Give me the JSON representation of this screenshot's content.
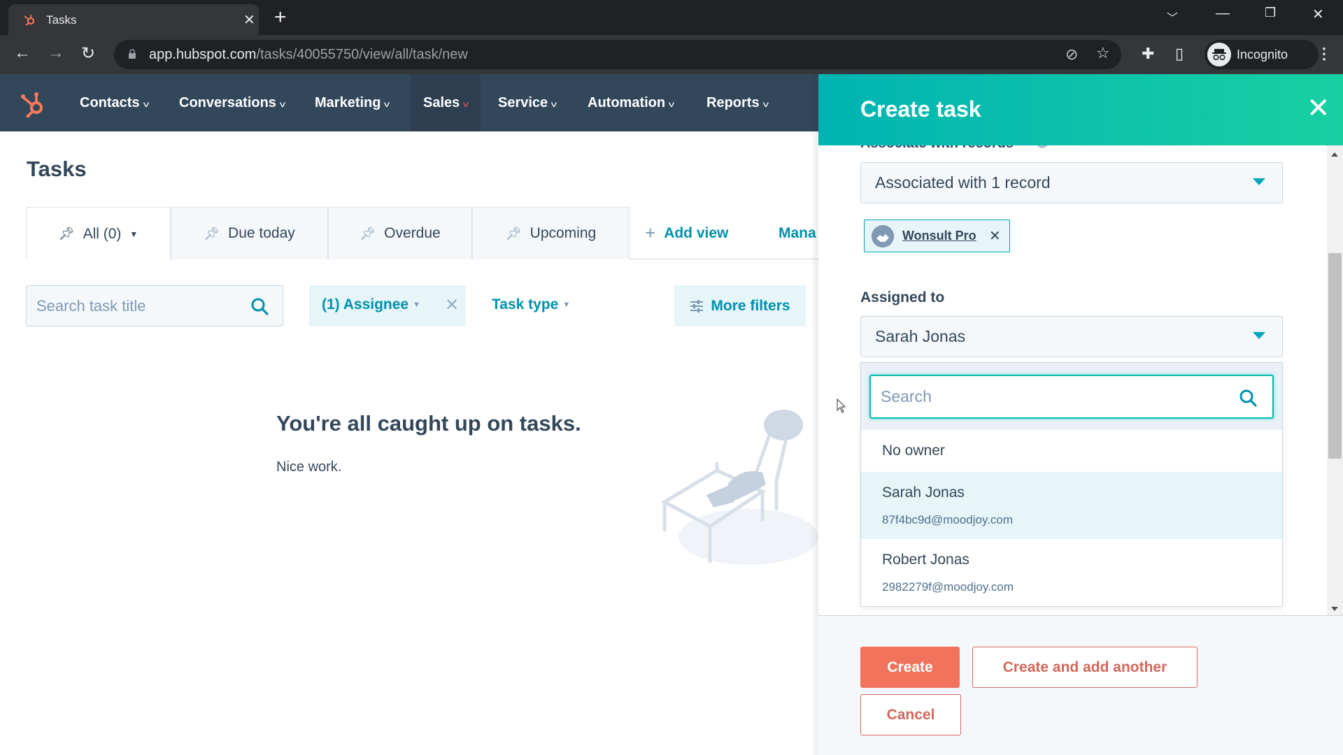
{
  "browser": {
    "tab_title": "Tasks",
    "tab_favicon": "hubspot-sprocket-icon",
    "new_tab_label": "+",
    "url_domain": "app.hubspot.com",
    "url_path": "/tasks/40055750/view/all/task/new",
    "profile_label": "Incognito",
    "icons": [
      "back-icon",
      "forward-icon",
      "reload-icon",
      "lock-icon",
      "eye-off-icon",
      "star-icon",
      "extensions-icon",
      "sidepanel-icon",
      "incognito-icon",
      "kebab-menu-icon",
      "tab-search-icon",
      "minimize-icon",
      "restore-icon",
      "close-window-icon"
    ]
  },
  "nav": {
    "items": [
      {
        "label": "Contacts"
      },
      {
        "label": "Conversations"
      },
      {
        "label": "Marketing"
      },
      {
        "label": "Sales",
        "active": true
      },
      {
        "label": "Service"
      },
      {
        "label": "Automation"
      },
      {
        "label": "Reports"
      }
    ],
    "chevron": "⌄"
  },
  "page": {
    "title": "Tasks",
    "view_tabs": [
      {
        "label": "All (0)",
        "active": true,
        "has_caret": true
      },
      {
        "label": "Due today"
      },
      {
        "label": "Overdue"
      },
      {
        "label": "Upcoming"
      }
    ],
    "add_view_label": "Add view",
    "manage_label": "Mana",
    "search_placeholder": "Search task title",
    "search_value": "",
    "assignee_filter_label": "(1) Assignee",
    "task_type_label": "Task type",
    "more_filters_label": "More filters",
    "empty_heading": "You're all caught up on tasks.",
    "empty_subtext": "Nice work."
  },
  "panel": {
    "title": "Create task",
    "associate_label": "Associate with records",
    "associate_value": "Associated with 1 record",
    "associated_record": "Wonsult Pro",
    "assigned_label": "Assigned to",
    "assigned_value": "Sarah Jonas",
    "dropdown": {
      "search_placeholder": "Search",
      "search_value": "",
      "options": [
        {
          "name": "No owner",
          "email": ""
        },
        {
          "name": "Sarah Jonas",
          "email": "87f4bc9d@moodjoy.com",
          "highlighted": true
        },
        {
          "name": "Robert Jonas",
          "email": "2982279f@moodjoy.com"
        }
      ]
    },
    "buttons": {
      "create": "Create",
      "create_another": "Create and add another",
      "cancel": "Cancel"
    }
  },
  "colors": {
    "nav_bg": "#33475b",
    "accent_teal": "#00a4bd",
    "link_teal": "#0091ae",
    "primary_coral": "#f2735c",
    "header_gradient_start": "#00b3b3",
    "header_gradient_end": "#17d0a2"
  }
}
